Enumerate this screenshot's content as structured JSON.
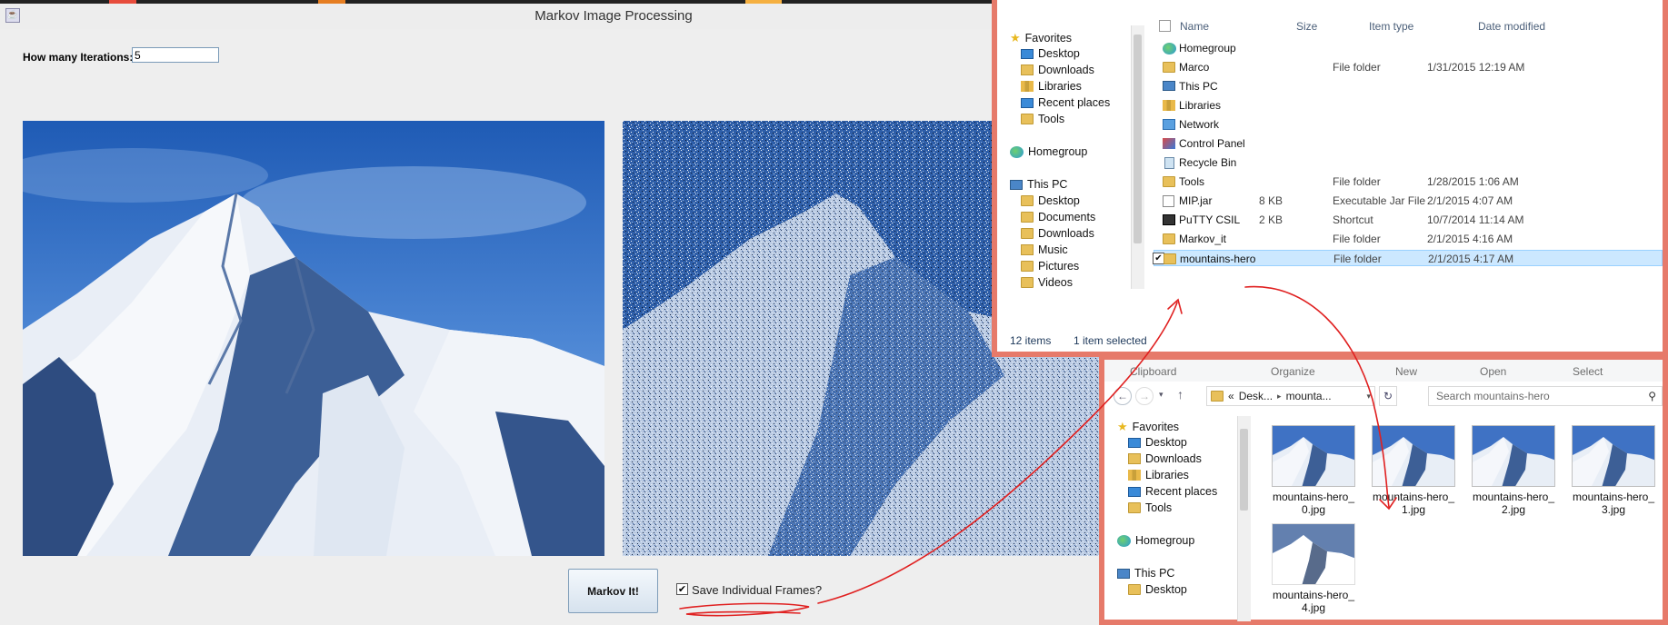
{
  "app": {
    "title": "Markov Image Processing",
    "iterations_label": "How many Iterations:",
    "iterations_value": "5",
    "markov_button": "Markov It!",
    "save_frames_label": "Save Individual Frames?",
    "save_frames_checked": true
  },
  "explorer1": {
    "columns": {
      "name": "Name",
      "size": "Size",
      "type": "Item type",
      "date": "Date modified"
    },
    "nav": {
      "favorites": "Favorites",
      "favorites_items": [
        "Desktop",
        "Downloads",
        "Libraries",
        "Recent places",
        "Tools"
      ],
      "homegroup": "Homegroup",
      "thispc": "This PC",
      "thispc_items": [
        "Desktop",
        "Documents",
        "Downloads",
        "Music",
        "Pictures",
        "Videos"
      ]
    },
    "files": [
      {
        "name": "Homegroup",
        "size": "",
        "type": "",
        "date": "",
        "icon": "homegroup-icon"
      },
      {
        "name": "Marco",
        "size": "",
        "type": "File folder",
        "date": "1/31/2015 12:19 AM",
        "icon": "folder-icon"
      },
      {
        "name": "This PC",
        "size": "",
        "type": "",
        "date": "",
        "icon": "computer-icon"
      },
      {
        "name": "Libraries",
        "size": "",
        "type": "",
        "date": "",
        "icon": "libraries-icon"
      },
      {
        "name": "Network",
        "size": "",
        "type": "",
        "date": "",
        "icon": "network-icon"
      },
      {
        "name": "Control Panel",
        "size": "",
        "type": "",
        "date": "",
        "icon": "control-panel-icon"
      },
      {
        "name": "Recycle Bin",
        "size": "",
        "type": "",
        "date": "",
        "icon": "recycle-bin-icon"
      },
      {
        "name": "Tools",
        "size": "",
        "type": "File folder",
        "date": "1/28/2015 1:06 AM",
        "icon": "folder-icon"
      },
      {
        "name": "MIP.jar",
        "size": "8 KB",
        "type": "Executable Jar File",
        "date": "2/1/2015 4:07 AM",
        "icon": "jar-icon"
      },
      {
        "name": "PuTTY CSIL",
        "size": "2 KB",
        "type": "Shortcut",
        "date": "10/7/2014 11:14 AM",
        "icon": "putty-icon"
      },
      {
        "name": "Markov_it",
        "size": "",
        "type": "File folder",
        "date": "2/1/2015 4:16 AM",
        "icon": "folder-icon"
      },
      {
        "name": "mountains-hero",
        "size": "",
        "type": "File folder",
        "date": "2/1/2015 4:17 AM",
        "icon": "folder-icon"
      }
    ],
    "status_items": "12 items",
    "status_selected": "1 item selected"
  },
  "explorer2": {
    "ribbon": [
      "Clipboard",
      "Organize",
      "New",
      "Open",
      "Select"
    ],
    "address_prefix": "«",
    "address_part1": "Desk...",
    "address_part2": "mounta...",
    "search_placeholder": "Search mountains-hero",
    "nav": {
      "favorites": "Favorites",
      "favorites_items": [
        "Desktop",
        "Downloads",
        "Libraries",
        "Recent places",
        "Tools"
      ],
      "homegroup": "Homegroup",
      "thispc": "This PC",
      "thispc_first": "Desktop"
    },
    "thumbnails": [
      {
        "line1": "mountains-hero_",
        "line2": "0.jpg"
      },
      {
        "line1": "mountains-hero_",
        "line2": "1.jpg"
      },
      {
        "line1": "mountains-hero_",
        "line2": "2.jpg"
      },
      {
        "line1": "mountains-hero_",
        "line2": "3.jpg"
      },
      {
        "line1": "mountains-hero_",
        "line2": "4.jpg"
      }
    ]
  },
  "colors": {
    "window_border": "#e67a6a",
    "selection": "#cce8ff",
    "annotation": "#e02020"
  }
}
